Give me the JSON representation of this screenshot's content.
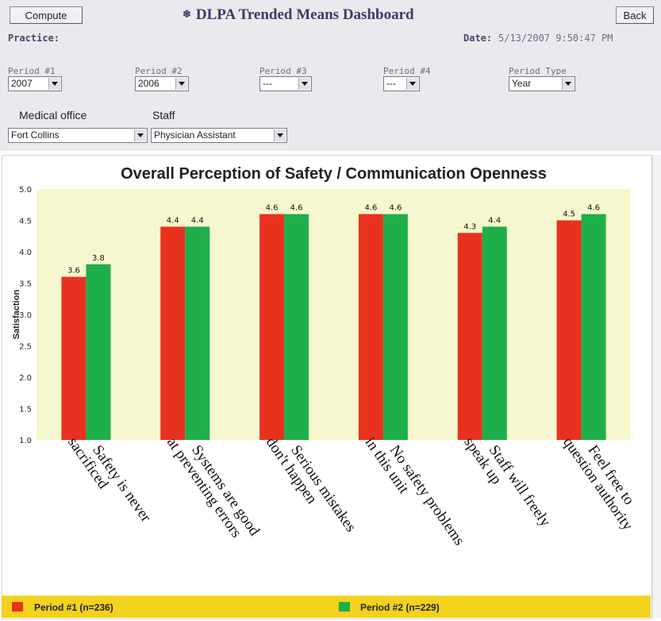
{
  "header": {
    "compute_label": "Compute",
    "title": "DLPA Trended Means Dashboard",
    "back_label": "Back",
    "practice_label": "Practice:",
    "date_label": "Date:",
    "date_value": "5/13/2007 9:50:47 PM"
  },
  "periods": [
    {
      "label": "Period #1",
      "value": "2007"
    },
    {
      "label": "Period #2",
      "value": "2006"
    },
    {
      "label": "Period #3",
      "value": "---"
    },
    {
      "label": "Period #4",
      "value": "---"
    },
    {
      "label": "Period Type",
      "value": "Year"
    }
  ],
  "filters": {
    "office_label": "Medical office",
    "office_value": "Fort Collins",
    "staff_label": "Staff",
    "staff_value": "Physician Assistant"
  },
  "colors": {
    "period1": "#e8321e",
    "period2": "#1eaf4b",
    "plot_bg": "#f7f7cf",
    "legend_bar": "#f3d21e"
  },
  "chart_data": {
    "type": "bar",
    "title": "Overall Perception of Safety / Communication Openness",
    "ylabel": "Satisfaction",
    "xlabel": "",
    "ylim": [
      1.0,
      5.0
    ],
    "yticks": [
      "1.0",
      "1.5",
      "2.0",
      "2.5",
      "3.0",
      "3.5",
      "4.0",
      "4.5",
      "5.0"
    ],
    "categories": [
      [
        "Safety is never",
        "sacrificed"
      ],
      [
        "Systems are good",
        "at preventing errors"
      ],
      [
        "Serious mistakes",
        "don't happen"
      ],
      [
        "No safety problems",
        "in this unit"
      ],
      [
        "Staff will freely",
        "speak up"
      ],
      [
        "Feel free to",
        "question authority"
      ]
    ],
    "series": [
      {
        "name": "Period #1 (n=236)",
        "values": [
          3.6,
          4.4,
          4.6,
          4.6,
          4.3,
          4.5
        ],
        "labels": [
          "3.6",
          "4.4",
          "4.6",
          "4.6",
          "4.3",
          "4.5"
        ]
      },
      {
        "name": "Period #2 (n=229)",
        "values": [
          3.8,
          4.4,
          4.6,
          4.6,
          4.4,
          4.6
        ],
        "labels": [
          "3.8",
          "4.4",
          "4.6",
          "4.6",
          "4.4",
          "4.6"
        ]
      }
    ],
    "grid": false,
    "legend": "bottom"
  }
}
